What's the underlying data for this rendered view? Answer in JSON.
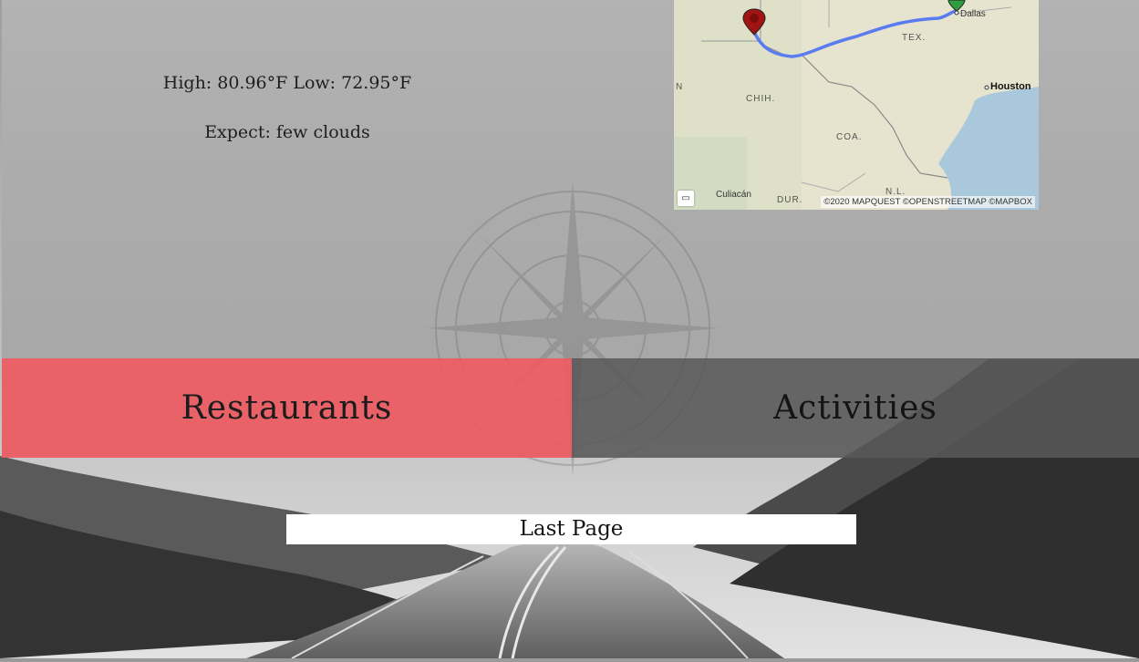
{
  "weather": {
    "high_low": "High: 80.96°F Low: 72.95°F",
    "expect": "Expect: few clouds"
  },
  "map": {
    "labels": {
      "dallas": "Dallas",
      "tex": "TEX.",
      "houston": "Houston",
      "chih": "CHIH.",
      "coa": "COA.",
      "culiacan": "Culiacán",
      "dur": "DUR.",
      "nl": "N.L.",
      "n": "N"
    },
    "attribution": "©2020 MAPQUEST ©OPENSTREETMAP ©MAPBOX",
    "colors": {
      "route": "#5b7cf0",
      "start_marker": "#2e9e3e",
      "end_marker": "#a01414"
    }
  },
  "buttons": {
    "restaurants": "Restaurants",
    "activities": "Activities",
    "last_page": "Last Page"
  },
  "colors": {
    "restaurants_bg": "#eb5a61",
    "activities_bg": "#585858"
  }
}
